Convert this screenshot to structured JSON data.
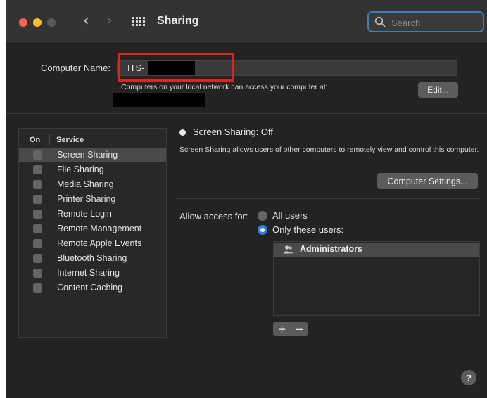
{
  "window": {
    "title": "Sharing",
    "icons": {
      "close": "close-icon",
      "minimize": "minimize-icon",
      "zoom": "zoom-icon",
      "back": "chevron-left-icon",
      "forward": "chevron-right-icon",
      "grid": "grid-icon",
      "search": "search-icon"
    },
    "search": {
      "placeholder": "Search",
      "value": ""
    }
  },
  "computer_name": {
    "label": "Computer Name:",
    "value": "ITS-",
    "subtitle": "Computers on your local network can access your computer at:",
    "edit_label": "Edit..."
  },
  "services": {
    "header_on": "On",
    "header_service": "Service",
    "items": [
      {
        "label": "Screen Sharing",
        "checked": false,
        "selected": true
      },
      {
        "label": "File Sharing",
        "checked": false,
        "selected": false
      },
      {
        "label": "Media Sharing",
        "checked": false,
        "selected": false
      },
      {
        "label": "Printer Sharing",
        "checked": false,
        "selected": false
      },
      {
        "label": "Remote Login",
        "checked": false,
        "selected": false
      },
      {
        "label": "Remote Management",
        "checked": false,
        "selected": false
      },
      {
        "label": "Remote Apple Events",
        "checked": false,
        "selected": false
      },
      {
        "label": "Bluetooth Sharing",
        "checked": false,
        "selected": false
      },
      {
        "label": "Internet Sharing",
        "checked": false,
        "selected": false
      },
      {
        "label": "Content Caching",
        "checked": false,
        "selected": false
      }
    ]
  },
  "detail": {
    "status": "Screen Sharing: Off",
    "description": "Screen Sharing allows users of other computers to remotely view and control this computer.",
    "computer_settings_label": "Computer Settings...",
    "access_label": "Allow access for:",
    "options": [
      {
        "label": "All users",
        "selected": false
      },
      {
        "label": "Only these users:",
        "selected": true
      }
    ],
    "users": [
      {
        "label": "Administrators",
        "icon": "group-icon"
      }
    ],
    "add_label": "+",
    "remove_label": "−",
    "help_label": "?"
  },
  "colors": {
    "accent": "#2f7fd9",
    "highlight_box": "#e0261c",
    "window_bg": "#232323"
  }
}
